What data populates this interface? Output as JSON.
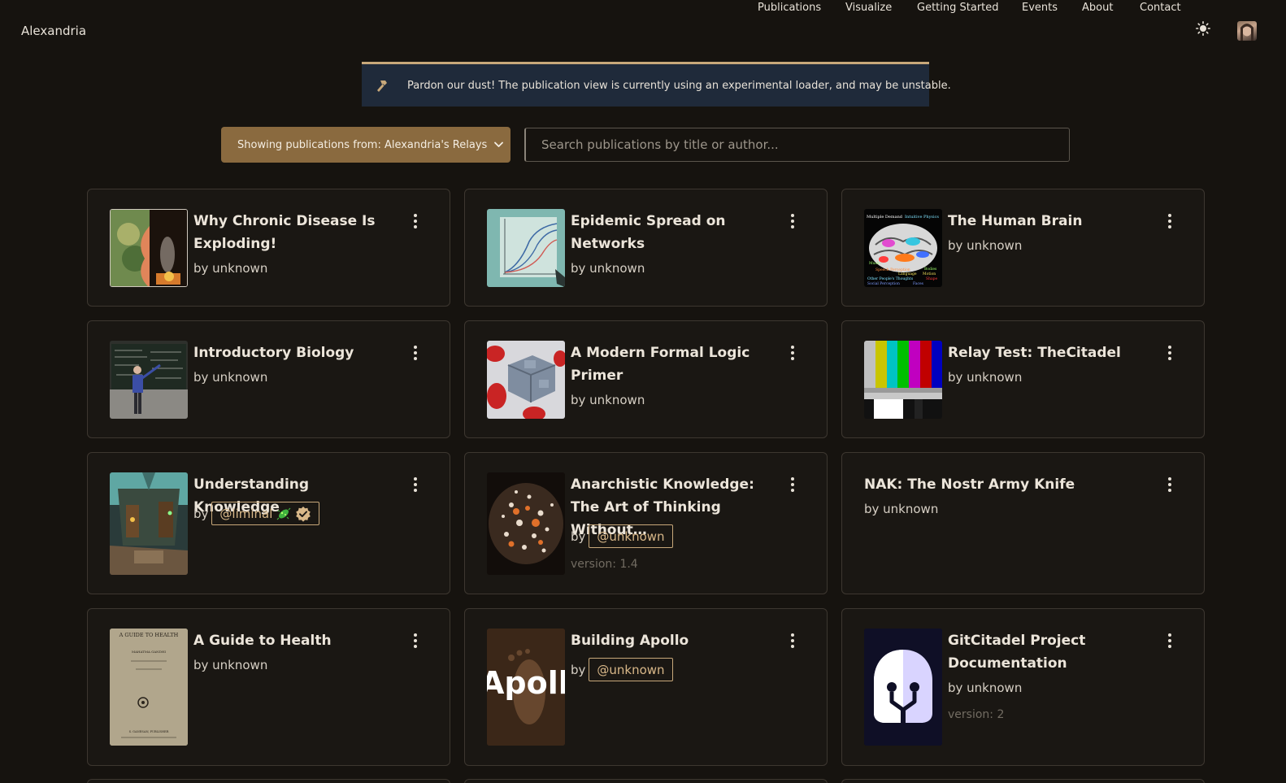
{
  "header": {
    "brand": "Alexandria",
    "nav": [
      "Publications",
      "Visualize",
      "Getting Started",
      "Events",
      "About",
      "Contact"
    ]
  },
  "banner": {
    "message": "Pardon our dust! The publication view is currently using an experimental loader, and may be unstable."
  },
  "controls": {
    "relay_label": "Showing publications from: Alexandria's Relays",
    "search_placeholder": "Search publications by title or author..."
  },
  "colors": {
    "background": "#16130f",
    "accent": "#8a6a3f",
    "badge": "#c8a87a",
    "banner": "#1f2a3a"
  },
  "cards": [
    {
      "title": "Why Chronic Disease Is Exploding!",
      "by": "by unknown"
    },
    {
      "title": "Epidemic Spread on Networks",
      "by": "by unknown"
    },
    {
      "title": "The Human Brain",
      "by": "by unknown"
    },
    {
      "title": "Introductory Biology",
      "by": "by unknown"
    },
    {
      "title": "A Modern Formal Logic Primer",
      "by": "by unknown"
    },
    {
      "title": "Relay Test: TheCitadel",
      "by": "by unknown"
    },
    {
      "title": "Understanding Knowledge",
      "by_prefix": "by",
      "author": "@liminal"
    },
    {
      "title": "Anarchistic Knowledge: The Art of Thinking Without…",
      "by_prefix": "by",
      "author": "@unknown",
      "version": "version: 1.4"
    },
    {
      "title": "NAK: The Nostr Army Knife",
      "by": "by unknown"
    },
    {
      "title": "A Guide to Health",
      "by": "by unknown"
    },
    {
      "title": "Building Apollo",
      "by_prefix": "by",
      "author": "@unknown"
    },
    {
      "title": "GitCitadel Project Documentation",
      "by": "by unknown",
      "version": "version: 2"
    }
  ],
  "thumb_texts": {
    "brain_labels": [
      "Multiple Demand",
      "Intuitive Physics",
      "Music",
      "Speech Perception",
      "Language",
      "Motion",
      "Other People's Thoughts",
      "Social Perception",
      "Faces",
      "Bodies",
      "Shape"
    ],
    "book_title": "A GUIDE TO HEALTH",
    "book_author": "MAHATMA GANDHI",
    "book_publisher": "S. GANESAN, PUBLISHER",
    "apollo": "Apollo"
  }
}
